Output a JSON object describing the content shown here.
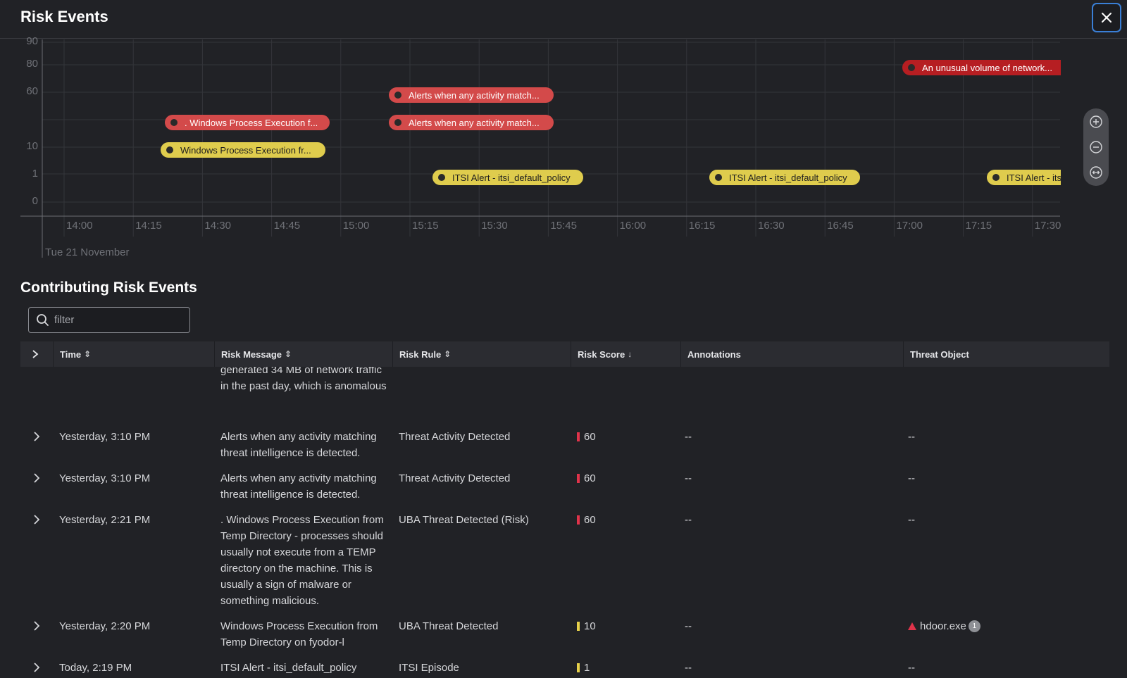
{
  "header": {
    "title": "Risk Events"
  },
  "chart": {
    "y_ticks": [
      "90",
      "80",
      "60",
      "10",
      "1",
      "0"
    ],
    "x_ticks": [
      "14:00",
      "14:15",
      "14:30",
      "14:45",
      "15:00",
      "15:15",
      "15:30",
      "15:45",
      "16:00",
      "16:15",
      "16:30",
      "16:45",
      "17:00",
      "17:15",
      "17:30"
    ],
    "date_label": "Tue 21 November",
    "events": [
      {
        "label": "An unusual volume of network...",
        "color": "#b61e22",
        "score": 80,
        "time": "17:05"
      },
      {
        "label": "Alerts when any activity match...",
        "color": "#d34a4a",
        "score": 60,
        "time": "15:10"
      },
      {
        "label": ". Windows Process Execution f...",
        "color": "#d34a4a",
        "score": 60,
        "time": "14:21"
      },
      {
        "label": "Alerts when any activity match...",
        "color": "#d34a4a",
        "score": 60,
        "time": "15:10"
      },
      {
        "label": "Windows Process Execution fr...",
        "color": "#dfcc4d",
        "score": 10,
        "time": "14:20"
      },
      {
        "label": "ITSI Alert - itsi_default_policy",
        "color": "#dfcc4d",
        "score": 1,
        "time": "15:19"
      },
      {
        "label": "ITSI Alert - itsi_default_policy",
        "color": "#dfcc4d",
        "score": 1,
        "time": "16:19"
      },
      {
        "label": "ITSI Alert - its",
        "color": "#dfcc4d",
        "score": 1,
        "time": "17:19"
      }
    ]
  },
  "zoom": {
    "zoom_in_icon": "plus-circle-icon",
    "zoom_out_icon": "minus-circle-icon",
    "fit_icon": "fit-width-icon"
  },
  "section": {
    "title": "Contributing Risk Events"
  },
  "filter": {
    "placeholder": "filter",
    "value": ""
  },
  "table": {
    "columns": {
      "time": "Time",
      "risk_message": "Risk Message",
      "risk_rule": "Risk Rule",
      "risk_score": "Risk Score",
      "annotations": "Annotations",
      "threat_object": "Threat Object"
    },
    "partial_row": {
      "message": "generated 34 MB of network traffic in the past day, which is anomalous"
    },
    "rows": [
      {
        "time": "Yesterday, 3:10 PM",
        "message": "Alerts when any activity matching threat intelligence is detected.",
        "rule": "Threat Activity Detected",
        "score": "60",
        "score_color": "#e0334a",
        "annotations": "--",
        "threat": "--"
      },
      {
        "time": "Yesterday, 3:10 PM",
        "message": "Alerts when any activity matching threat intelligence is detected.",
        "rule": "Threat Activity Detected",
        "score": "60",
        "score_color": "#e0334a",
        "annotations": "--",
        "threat": "--"
      },
      {
        "time": "Yesterday, 2:21 PM",
        "message": ". Windows Process Execution from Temp Directory - processes should usually not execute from a TEMP directory on the machine. This is usually a sign of malware or something malicious.",
        "rule": "UBA Threat Detected (Risk)",
        "score": "60",
        "score_color": "#e0334a",
        "annotations": "--",
        "threat": "--"
      },
      {
        "time": "Yesterday, 2:20 PM",
        "message": "Windows Process Execution from Temp Directory on fyodor-l",
        "rule": "UBA Threat Detected",
        "score": "10",
        "score_color": "#e6d04a",
        "annotations": "--",
        "threat": "hdoor.exe",
        "threat_count": "1"
      },
      {
        "time": "Today, 2:19 PM",
        "message": "ITSI Alert - itsi_default_policy",
        "rule": "ITSI Episode",
        "score": "1",
        "score_color": "#e6d04a",
        "annotations": "--",
        "threat": "--"
      }
    ]
  }
}
